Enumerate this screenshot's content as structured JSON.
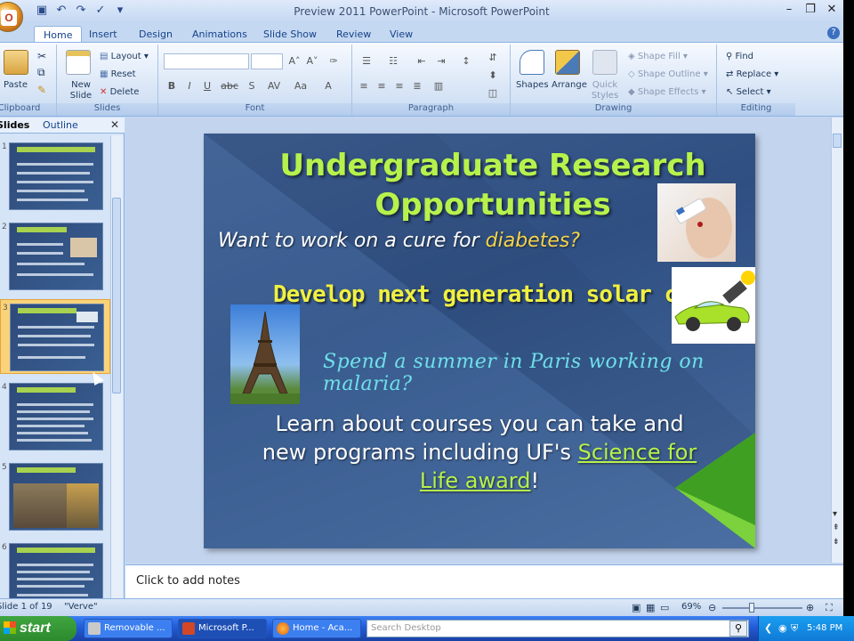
{
  "window": {
    "title": "Preview 2011 PowerPoint - Microsoft PowerPoint"
  },
  "ribbon_tabs": [
    "Home",
    "Insert",
    "Design",
    "Animations",
    "Slide Show",
    "Review",
    "View"
  ],
  "groups": {
    "clipboard": "Clipboard",
    "slides": "Slides",
    "font": "Font",
    "paragraph": "Paragraph",
    "drawing": "Drawing",
    "editing": "Editing"
  },
  "buttons": {
    "paste": "Paste",
    "new_slide": "New Slide",
    "layout": "Layout",
    "reset": "Reset",
    "delete": "Delete",
    "shapes": "Shapes",
    "arrange": "Arrange",
    "quick_styles": "Quick Styles",
    "shape_fill": "Shape Fill",
    "shape_outline": "Shape Outline",
    "shape_effects": "Shape Effects",
    "find": "Find",
    "replace": "Replace",
    "select": "Select"
  },
  "panel_tabs": {
    "slides": "Slides",
    "outline": "Outline"
  },
  "thumbnails": [
    {
      "num": "1"
    },
    {
      "num": "2"
    },
    {
      "num": "3"
    },
    {
      "num": "4"
    },
    {
      "num": "5"
    },
    {
      "num": "6"
    }
  ],
  "slide": {
    "title_line1": "Undergraduate Research",
    "title_line2": "Opportunities",
    "bullet1_pre": "Want to work on a cure for ",
    "bullet1_hl": "diabetes?",
    "bullet2": "Develop next generation solar cells?",
    "bullet3": "Spend a summer in Paris working on malaria?",
    "bullet4_line1": "Learn about courses you can take and",
    "bullet4_line2_pre": "new programs including UF's ",
    "bullet4_link1": "Science for",
    "bullet4_link2": "Life award",
    "bullet4_end": "!"
  },
  "notes": "Click to add notes",
  "status": {
    "slide_count": "Slide 1 of 19",
    "theme": "\"Verve\"",
    "zoom": "69%"
  },
  "taskbar": {
    "start": "start",
    "items": [
      "Removable ...",
      "Microsoft P...",
      "Home - Aca..."
    ],
    "search_placeholder": "Search Desktop",
    "clock": "5:48 PM"
  }
}
